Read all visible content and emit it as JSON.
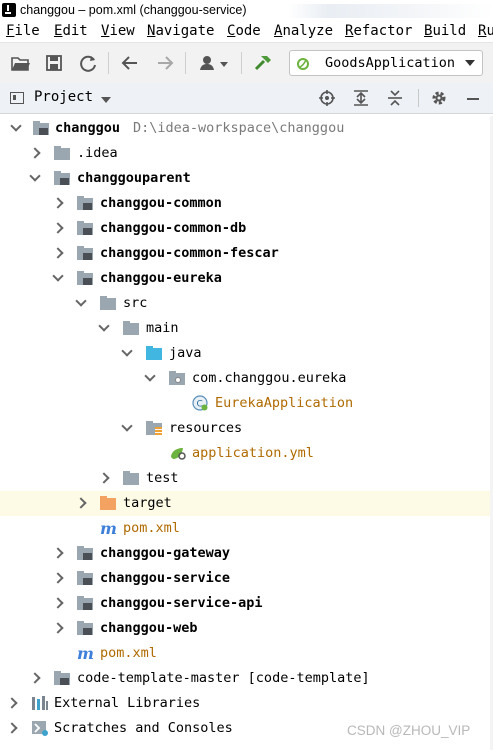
{
  "window": {
    "title": "changgou – pom.xml (changgou-service)"
  },
  "menu": [
    "File",
    "Edit",
    "View",
    "Navigate",
    "Code",
    "Analyze",
    "Refactor",
    "Build",
    "Ru"
  ],
  "toolbar": {
    "buttons": [
      "open-icon",
      "save-icon",
      "sync-icon",
      "back-icon",
      "forward-icon",
      "vcs-user-icon",
      "build-hammer-icon"
    ],
    "run_config": "GoodsApplication"
  },
  "project_panel": {
    "title": "Project",
    "tools": [
      "locate-icon",
      "expand-all-icon",
      "collapse-all-icon",
      "settings-gear-icon",
      "hide-icon"
    ]
  },
  "tree": [
    {
      "label": "changgou",
      "path": "D:\\idea-workspace\\changgou",
      "icon": "module-folder-icon",
      "expanded": true
    },
    {
      "label": ".idea",
      "icon": "folder-icon",
      "expanded": false
    },
    {
      "label": "changgouparent",
      "icon": "module-folder-icon",
      "expanded": true
    },
    {
      "label": "changgou-common",
      "icon": "module-folder-icon",
      "expanded": false
    },
    {
      "label": "changgou-common-db",
      "icon": "module-folder-icon",
      "expanded": false
    },
    {
      "label": "changgou-common-fescar",
      "icon": "module-folder-icon",
      "expanded": false
    },
    {
      "label": "changgou-eureka",
      "icon": "module-folder-icon",
      "expanded": true
    },
    {
      "label": "src",
      "icon": "folder-icon",
      "expanded": true
    },
    {
      "label": "main",
      "icon": "folder-icon",
      "expanded": true
    },
    {
      "label": "java",
      "icon": "source-folder-icon",
      "expanded": true
    },
    {
      "label": "com.changgou.eureka",
      "icon": "package-icon",
      "expanded": true
    },
    {
      "label": "EurekaApplication",
      "icon": "spring-class-icon"
    },
    {
      "label": "resources",
      "icon": "resources-folder-icon",
      "expanded": true
    },
    {
      "label": "application.yml",
      "icon": "spring-yml-icon"
    },
    {
      "label": "test",
      "icon": "folder-icon",
      "expanded": false
    },
    {
      "label": "target",
      "icon": "excluded-folder-icon",
      "expanded": false
    },
    {
      "label": "pom.xml",
      "icon": "maven-icon"
    },
    {
      "label": "changgou-gateway",
      "icon": "module-folder-icon",
      "expanded": false
    },
    {
      "label": "changgou-service",
      "icon": "module-folder-icon",
      "expanded": false
    },
    {
      "label": "changgou-service-api",
      "icon": "module-folder-icon",
      "expanded": false
    },
    {
      "label": "changgou-web",
      "icon": "module-folder-icon",
      "expanded": false
    },
    {
      "label": "pom.xml",
      "icon": "maven-icon"
    },
    {
      "label": "code-template-master [code-template]",
      "icon": "module-folder-icon",
      "expanded": false
    },
    {
      "label": "External Libraries",
      "icon": "libraries-icon",
      "expanded": false
    },
    {
      "label": "Scratches and Consoles",
      "icon": "scratches-icon",
      "expanded": false
    }
  ],
  "watermark": "CSDN @ZHOU_VIP"
}
